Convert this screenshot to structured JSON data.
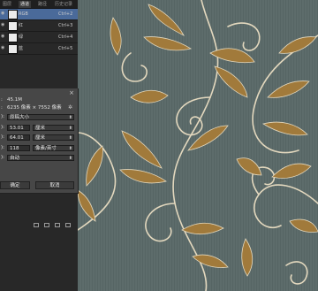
{
  "tabs": [
    "图层",
    "通道",
    "路径",
    "历史记录"
  ],
  "channels": [
    {
      "name": "RGB",
      "key": "Ctrl+2",
      "thumb": "light"
    },
    {
      "name": "红",
      "key": "Ctrl+3",
      "thumb": "light"
    },
    {
      "name": "绿",
      "key": "Ctrl+4",
      "thumb": "light"
    },
    {
      "name": "蓝",
      "key": "Ctrl+5",
      "thumb": "light"
    }
  ],
  "dialog": {
    "size_label": "45.1M",
    "dimensions": "6235 像素 × 7552 像素",
    "fit_select": "原稿大小",
    "width_value": "53.01",
    "width_unit": "厘米",
    "height_value": "64.01",
    "height_unit": "厘米",
    "res_value": "118",
    "res_unit": "像素/英寸",
    "resample": "自动",
    "ok_label": "确定",
    "cancel_label": "取消"
  },
  "colors": {
    "wallpaper_bg": "#5b6a69",
    "ornament_gold": "#a07a3c",
    "ornament_outline": "#e6dcc4",
    "panel_bg": "#282828",
    "selected_row": "#4a6a9a"
  },
  "icons": [
    "eye-icon",
    "close-icon",
    "gear-icon",
    "caret-down-icon",
    "new-channel-icon",
    "delete-channel-icon"
  ]
}
